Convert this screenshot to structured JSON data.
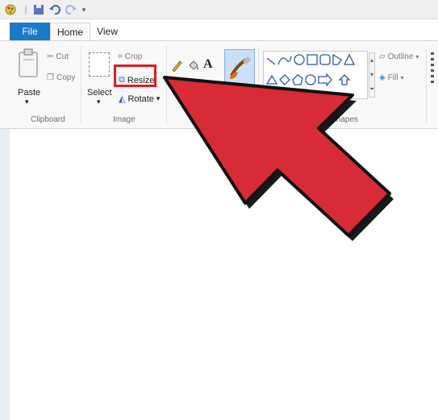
{
  "ribbon_tabs": {
    "file": "File",
    "home": "Home",
    "view": "View"
  },
  "clipboard": {
    "paste": "Paste",
    "cut": "Cut",
    "copy": "Copy",
    "group_label": "Clipboard"
  },
  "image": {
    "select": "Select",
    "crop": "Crop",
    "resize": "Resize",
    "rotate": "Rotate",
    "group_label": "Image"
  },
  "tools": {
    "text_tool": "A"
  },
  "shapes": {
    "outline": "Outline",
    "fill": "Fill",
    "group_label": "Shapes"
  },
  "colors": {
    "tab_file": "#1979ca",
    "highlight": "#e21c1c",
    "arrow": "#d92b36"
  }
}
